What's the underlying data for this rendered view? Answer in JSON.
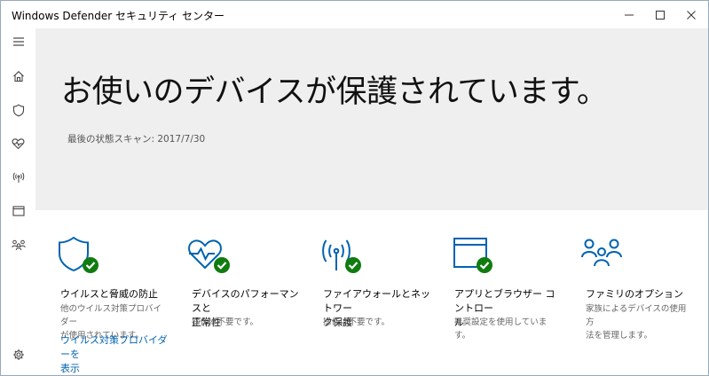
{
  "window": {
    "title": "Windows Defender セキュリティ センター"
  },
  "sidebar": {
    "icons": [
      "hamburger-menu-icon",
      "home-icon",
      "shield-icon",
      "heart-pulse-icon",
      "wireless-icon",
      "browser-window-icon",
      "family-icon",
      "settings-gear-icon"
    ]
  },
  "hero": {
    "headline": "お使いのデバイスが保護されています。",
    "last_scan": "最後の状態スキャン: 2017/7/30"
  },
  "accent_color": "#0063b1",
  "status_color": "#107c10",
  "cards": [
    {
      "icon": "shield-check-icon",
      "title_lines": [
        "ウイルスと脅威の防止"
      ],
      "desc_lines": [
        "他のウイルス対策プロバイダー",
        "が使用されています。"
      ],
      "link_lines": [
        "ウイルス対策プロバイダーを",
        "表示"
      ]
    },
    {
      "icon": "heart-check-icon",
      "title_lines": [
        "デバイスのパフォーマンスと",
        "正常性"
      ],
      "desc_lines": [
        "操作は不要です。"
      ]
    },
    {
      "icon": "wireless-check-icon",
      "title_lines": [
        "ファイアウォールとネットワー",
        "ク保護"
      ],
      "desc_lines": [
        "操作は不要です。"
      ]
    },
    {
      "icon": "browser-check-icon",
      "title_lines": [
        "アプリとブラウザー コントロー",
        "ル"
      ],
      "desc_lines": [
        "推奨設定を使用しています。"
      ]
    },
    {
      "icon": "family-icon",
      "title_lines": [
        "ファミリのオプション"
      ],
      "desc_lines": [
        "家族によるデバイスの使用方",
        "法を管理します。"
      ]
    }
  ]
}
